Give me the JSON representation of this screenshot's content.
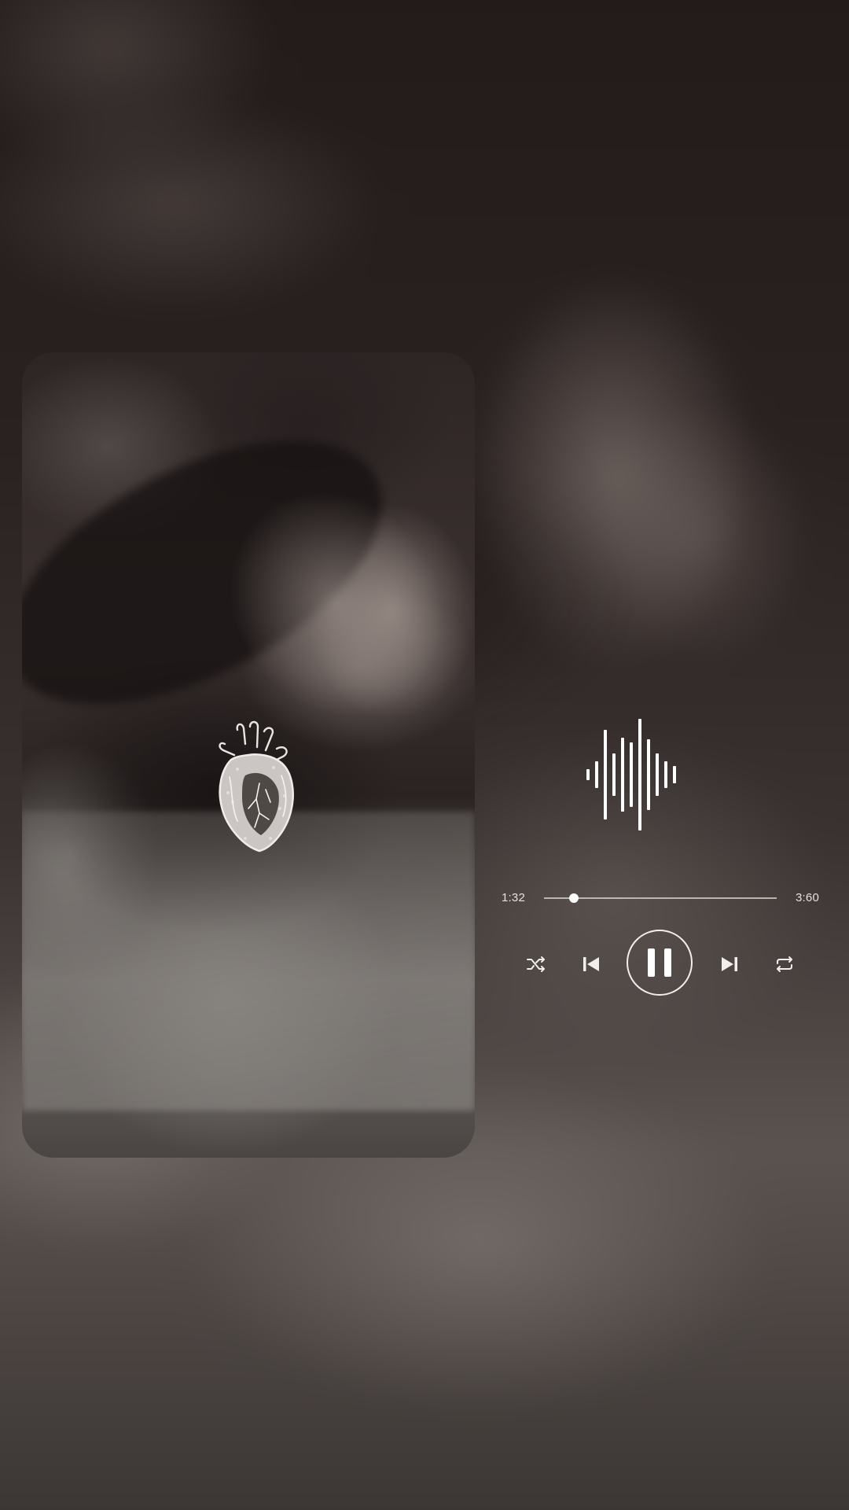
{
  "player": {
    "elapsed": "1:32",
    "total": "3:60",
    "progress_fraction": 0.13,
    "is_playing": true,
    "controls": [
      "shuffle-icon",
      "previous-icon",
      "pause-icon",
      "next-icon",
      "repeat-icon"
    ]
  },
  "visuals": {
    "artwork_decoration": "anatomical-heart-icon",
    "waveform": "sound-waveform-icon",
    "accent_color": "#ffffff"
  }
}
